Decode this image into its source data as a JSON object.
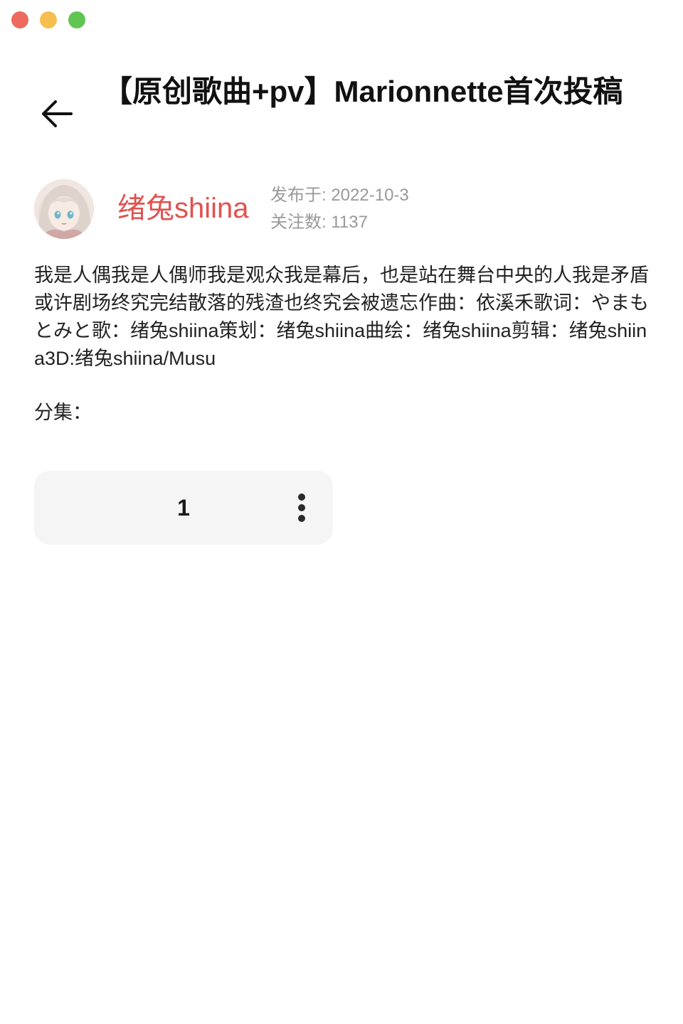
{
  "window": {
    "controls": [
      "close",
      "minimize",
      "maximize"
    ]
  },
  "header": {
    "back_icon": "arrow-left-icon",
    "title": "【原创歌曲+pv】Marionnette首次投稿"
  },
  "author": {
    "name": "绪兔shiina",
    "published": "发布于: 2022-10-3",
    "followers": "关注数: 1137"
  },
  "description": "我是人偶我是人偶师我是观众我是幕后，也是站在舞台中央的人我是矛盾或许剧场终究完结散落的残渣也终究会被遗忘作曲：依溪禾歌词：やまもとみと歌：绪兔shiina策划：绪兔shiina曲绘：绪兔shiina剪辑：绪兔shiina3D:绪兔shiina/Musu",
  "episodes": {
    "label": "分集：",
    "items": [
      {
        "number": "1",
        "more_icon": "more-vertical-icon"
      }
    ]
  },
  "colors": {
    "author_name": "#e0524f",
    "meta_text": "#999999",
    "card_bg": "#f5f5f5"
  }
}
